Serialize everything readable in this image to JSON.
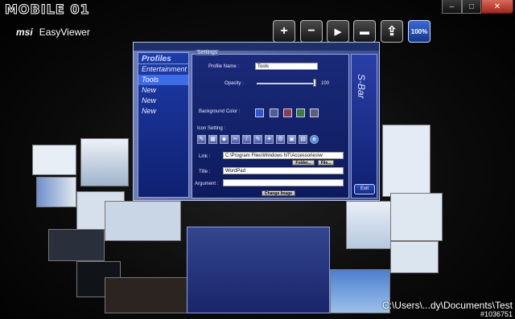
{
  "window": {
    "logo": "MOBILE 01",
    "brand_logo": "msi",
    "app_title": "EasyViewer",
    "controls": [
      "–",
      "□",
      "✕"
    ]
  },
  "toolbar": {
    "buttons": [
      {
        "icon": "plus-icon",
        "glyph": "+"
      },
      {
        "icon": "minus-icon",
        "glyph": "−"
      },
      {
        "icon": "play-icon",
        "glyph": "▶"
      },
      {
        "icon": "folder-icon",
        "glyph": "▬"
      },
      {
        "icon": "export-icon",
        "glyph": "⇪"
      }
    ],
    "zoom_label": "100%"
  },
  "dialog": {
    "profiles_header": "Profiles",
    "profiles": [
      "Entertainment",
      "Tools",
      "New",
      "New",
      "New"
    ],
    "selected_profile": 1,
    "settings_title": "Settings",
    "profile_name_label": "Profile Name :",
    "profile_name_value": "Tools",
    "opacity_label": "Opacity :",
    "opacity_value": "100",
    "background_color_label": "Background Color :",
    "background_colors": [
      "#2b57d6",
      "#4f5d97",
      "#8a3a54",
      "#3f7a45",
      "#5a5f78"
    ],
    "icon_setting_label": "Icon Setting :",
    "link_label": "Link :",
    "link_value": "C:\\Program Files\\Windows NT\\Accessories\\w",
    "folder_button": "Folder...",
    "file_button": "File...",
    "title_label": "Title :",
    "title_value": "WordPad",
    "argument_label": "Argument :",
    "argument_value": "",
    "change_image_button": "Change Image",
    "sidebar_text": "S-Bar",
    "exit_button": "Exit"
  },
  "status_path": "C:\\Users\\...dy\\Documents\\Test",
  "watermark": "#1036751"
}
